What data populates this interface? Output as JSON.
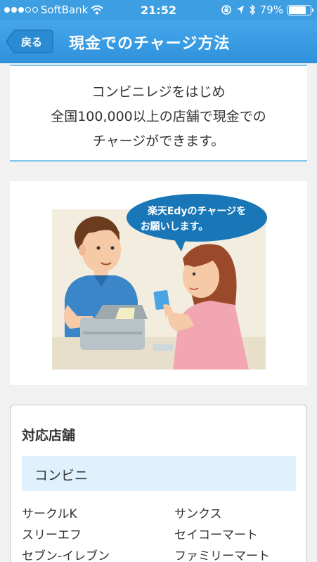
{
  "status_bar": {
    "carrier": "SoftBank",
    "time": "21:52",
    "battery": "79%",
    "battery_level": 0.79,
    "icons": [
      "signal-dots",
      "wifi-icon",
      "rotation-lock-icon",
      "location-icon",
      "bluetooth-icon",
      "battery-icon"
    ]
  },
  "nav": {
    "back_label": "戻る",
    "title": "現金でのチャージ方法"
  },
  "intro": {
    "lines": [
      "コンビニレジをはじめ",
      "全国100,000以上の店舗で現金での",
      "チャージができます。"
    ]
  },
  "illustration": {
    "speech_lines": [
      "楽天Edyのチャージを",
      "お願いします。"
    ]
  },
  "stores": {
    "heading": "対応店舗",
    "category": "コンビニ",
    "items": [
      "サークルK",
      "サンクス",
      "スリーエフ",
      "セイコーマート",
      "セブン-イレブン",
      "ファミリーマート"
    ]
  },
  "colors": {
    "accent": "#3d9fe2",
    "divider": "#7fc3ee",
    "category_bg": "#dff1fc"
  }
}
